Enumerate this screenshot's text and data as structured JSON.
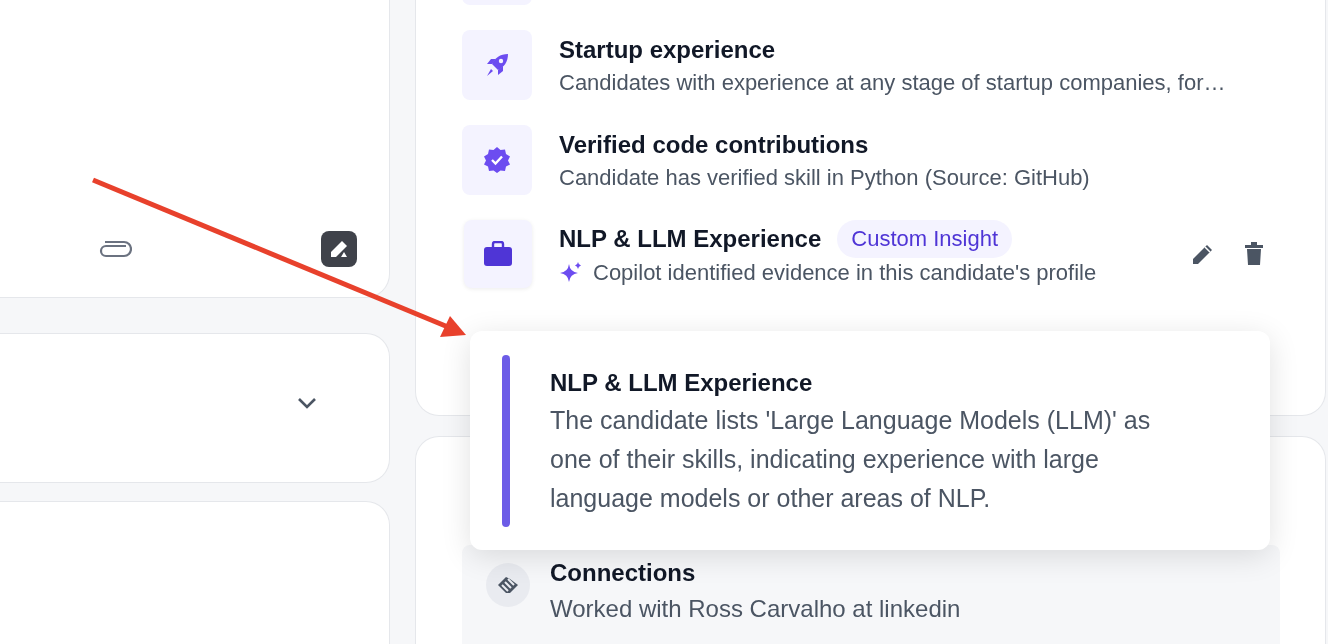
{
  "insights": [
    {
      "kind": "standard",
      "title": "Startup experience",
      "description": "Candidates with experience at any stage of startup companies, for…"
    },
    {
      "kind": "standard",
      "title": "Verified code contributions",
      "description": "Candidate has verified skill in Python (Source: GitHub)"
    },
    {
      "kind": "custom",
      "title": "NLP & LLM Experience",
      "badge": "Custom Insight",
      "description": "Copilot identified evidence in this candidate's profile"
    }
  ],
  "tooltip": {
    "title": "NLP & LLM Experience",
    "text": "The candidate lists 'Large Language Models (LLM)' as one of their skills, indicating experience with large language models or other areas of NLP."
  },
  "connections": {
    "title": "Connections",
    "text": "Worked with Ross Carvalho at linkedin"
  }
}
